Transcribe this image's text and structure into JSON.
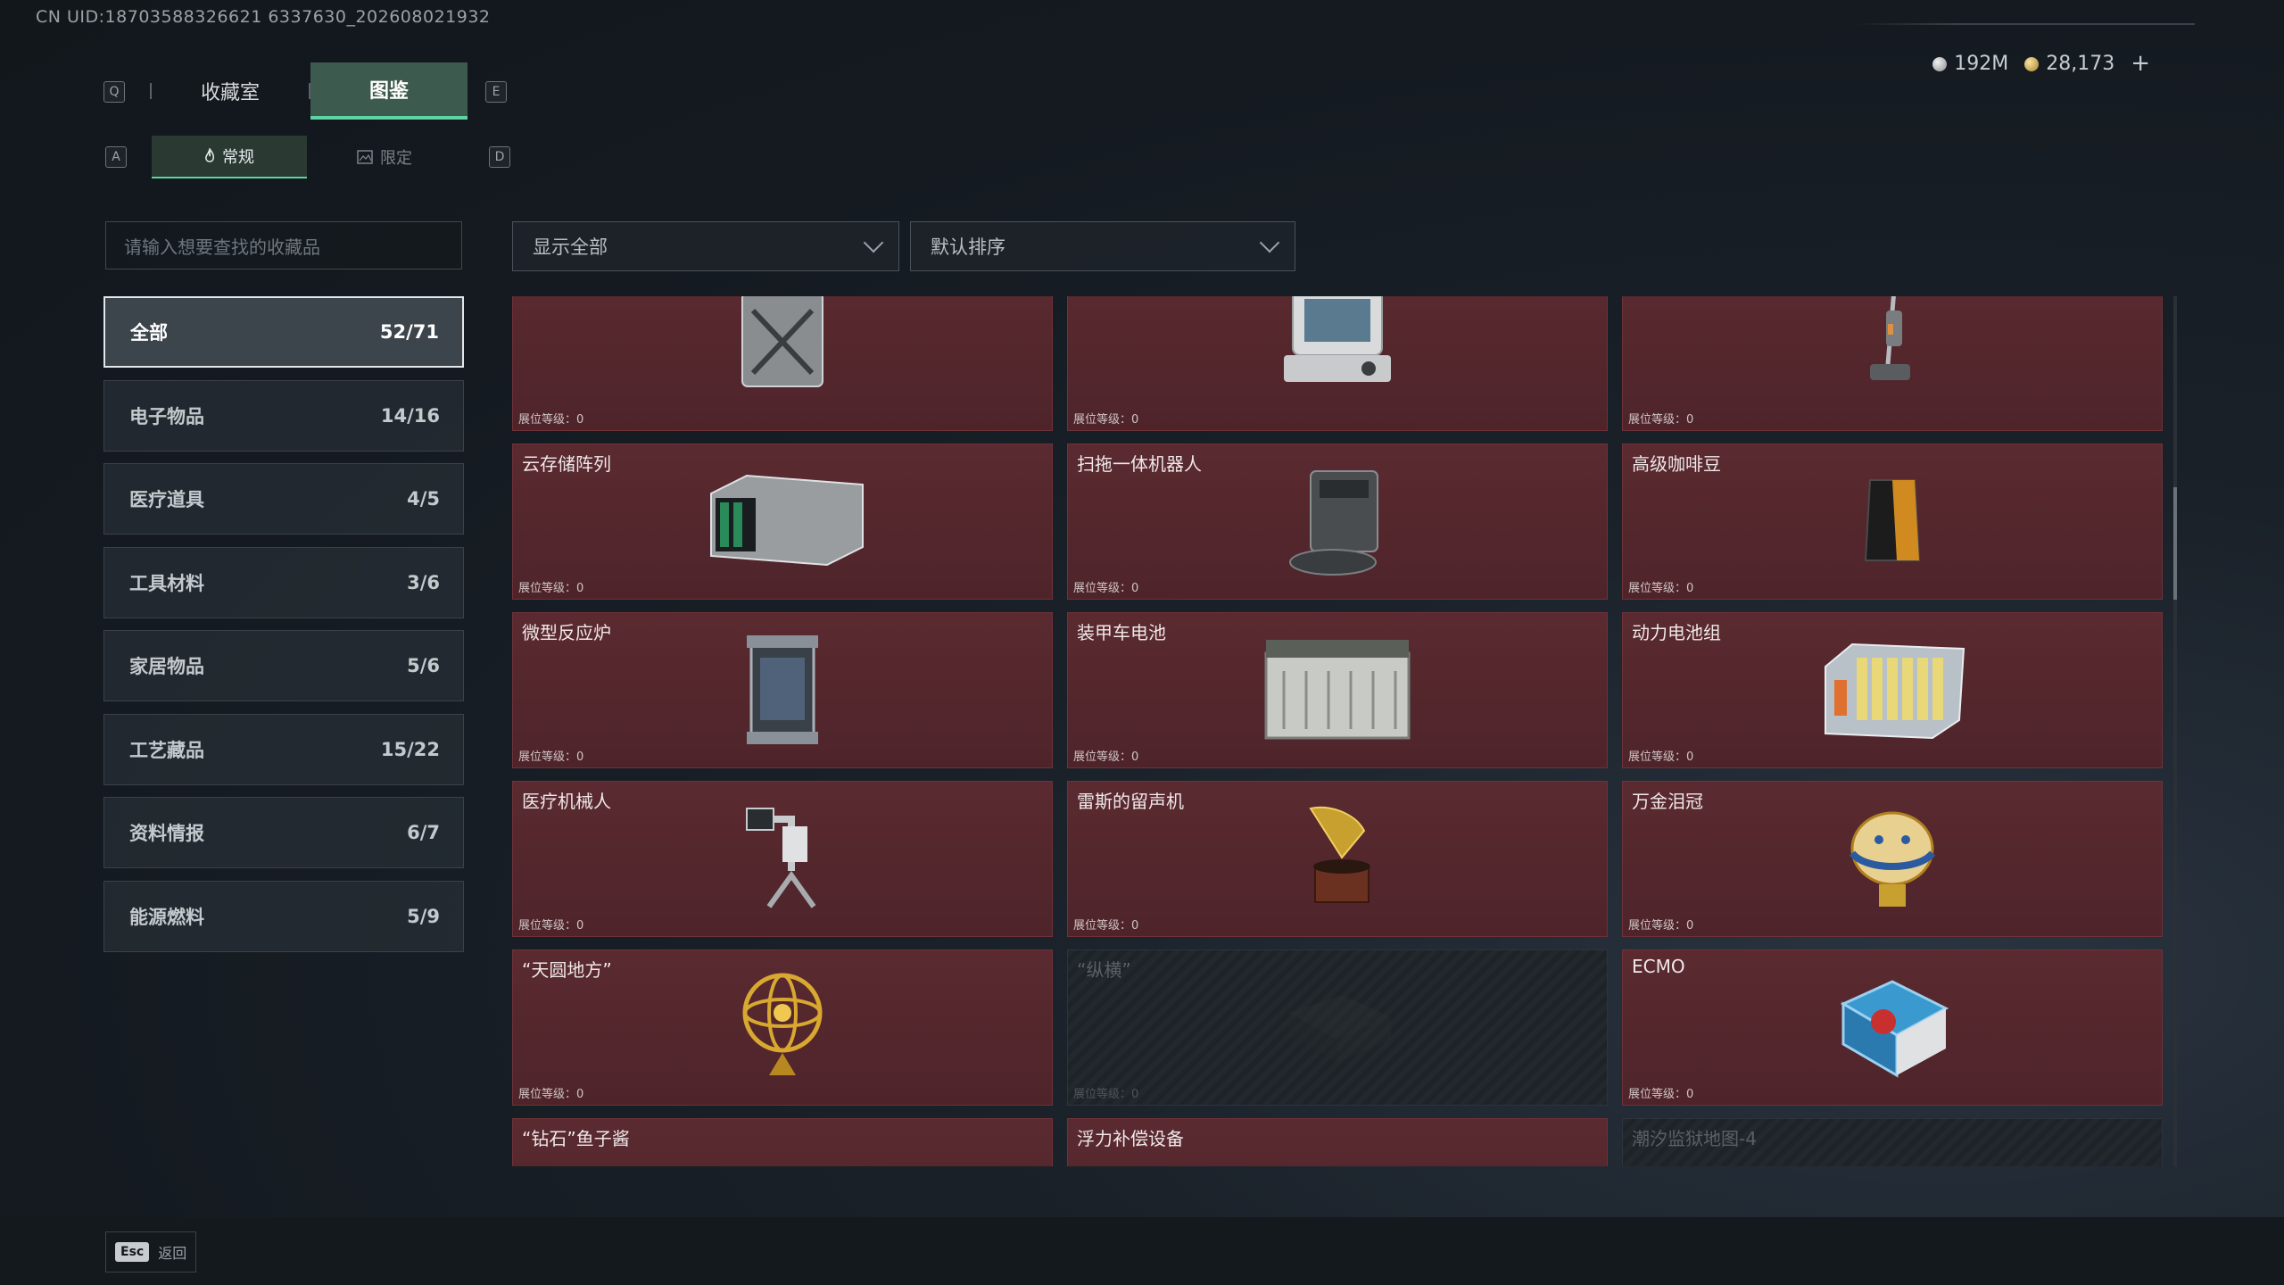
{
  "uid_text": "CN UID:18703588326621 6337630_202608021932",
  "keys": {
    "q": "Q",
    "e": "E",
    "a": "A",
    "d": "D"
  },
  "top_tabs": [
    {
      "label": "收藏室",
      "active": false
    },
    {
      "label": "图鉴",
      "active": true
    }
  ],
  "sub_tabs": [
    {
      "label": "常规",
      "active": true
    },
    {
      "label": "限定",
      "active": false
    }
  ],
  "currency": {
    "silver": "192M",
    "gold": "28,173",
    "add": "+"
  },
  "search": {
    "placeholder": "请输入想要查找的收藏品"
  },
  "filters": {
    "show": "显示全部",
    "sort": "默认排序"
  },
  "categories": [
    {
      "label": "全部",
      "count": "52/71",
      "active": true
    },
    {
      "label": "电子物品",
      "count": "14/16"
    },
    {
      "label": "医疗道具",
      "count": "4/5"
    },
    {
      "label": "工具材料",
      "count": "3/6"
    },
    {
      "label": "家居物品",
      "count": "5/6"
    },
    {
      "label": "工艺藏品",
      "count": "15/22"
    },
    {
      "label": "资料情报",
      "count": "6/7"
    },
    {
      "label": "能源燃料",
      "count": "5/9"
    }
  ],
  "level_label": "展位等级：0",
  "items": [
    {
      "name": "",
      "locked": false,
      "icon": "jerrycan-icon"
    },
    {
      "name": "",
      "locked": false,
      "icon": "retro-computer-icon"
    },
    {
      "name": "",
      "locked": false,
      "icon": "floor-washer-icon"
    },
    {
      "name": "云存储阵列",
      "locked": false,
      "icon": "storage-array-icon"
    },
    {
      "name": "扫拖一体机器人",
      "locked": false,
      "icon": "robot-vacuum-icon"
    },
    {
      "name": "高级咖啡豆",
      "locked": false,
      "icon": "coffee-bag-icon"
    },
    {
      "name": "微型反应炉",
      "locked": false,
      "icon": "micro-reactor-icon"
    },
    {
      "name": "装甲车电池",
      "locked": false,
      "icon": "vehicle-battery-icon"
    },
    {
      "name": "动力电池组",
      "locked": false,
      "icon": "battery-pack-icon"
    },
    {
      "name": "医疗机械人",
      "locked": false,
      "icon": "medical-robot-icon"
    },
    {
      "name": "雷斯的留声机",
      "locked": false,
      "icon": "gramophone-icon"
    },
    {
      "name": "万金泪冠",
      "locked": false,
      "icon": "jeweled-egg-icon"
    },
    {
      "name": "“天圆地方”",
      "locked": false,
      "icon": "armillary-sphere-icon"
    },
    {
      "name": "“纵横”",
      "locked": true,
      "icon": "board-game-icon"
    },
    {
      "name": "ECMO",
      "locked": false,
      "icon": "ecmo-device-icon"
    },
    {
      "name": "“钻石”鱼子酱",
      "locked": false,
      "icon": "caviar-tin-icon"
    },
    {
      "name": "浮力补偿设备",
      "locked": false,
      "icon": "bcd-vest-icon"
    },
    {
      "name": "潮汐监狱地图-4",
      "locked": true,
      "icon": "map-icon"
    }
  ],
  "footer": {
    "esc_key": "Esc",
    "esc_label": "返回"
  }
}
